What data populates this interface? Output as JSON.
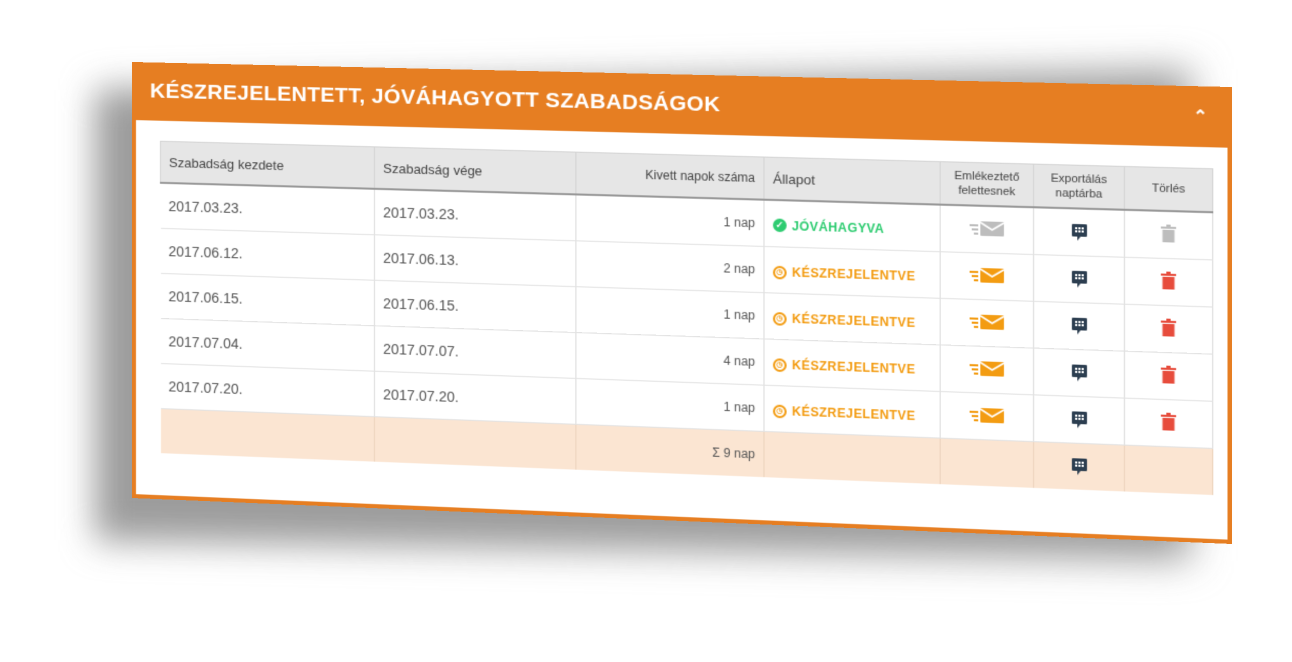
{
  "panel": {
    "title": "KÉSZREJELENTETT, JÓVÁHAGYOTT SZABADSÁGOK",
    "collapse_icon": "chevron-up-icon"
  },
  "table": {
    "headers": {
      "start": "Szabadság kezdete",
      "end": "Szabadság vége",
      "days": "Kivett napok száma",
      "status": "Állapot",
      "remind": "Emlékeztető felettesnek",
      "export": "Exportálás naptárba",
      "delete": "Törlés"
    },
    "rows": [
      {
        "start": "2017.03.23.",
        "end": "2017.03.23.",
        "days": "1 nap",
        "status": "JÓVÁHAGYVA",
        "status_type": "approved"
      },
      {
        "start": "2017.06.12.",
        "end": "2017.06.13.",
        "days": "2 nap",
        "status": "KÉSZREJELENTVE",
        "status_type": "pending"
      },
      {
        "start": "2017.06.15.",
        "end": "2017.06.15.",
        "days": "1 nap",
        "status": "KÉSZREJELENTVE",
        "status_type": "pending"
      },
      {
        "start": "2017.07.04.",
        "end": "2017.07.07.",
        "days": "4 nap",
        "status": "KÉSZREJELENTVE",
        "status_type": "pending"
      },
      {
        "start": "2017.07.20.",
        "end": "2017.07.20.",
        "days": "1 nap",
        "status": "KÉSZREJELENTVE",
        "status_type": "pending"
      }
    ],
    "sum": "Σ 9 nap"
  },
  "colors": {
    "accent": "#e67e22",
    "approved": "#2ecc71",
    "pending": "#f39c12",
    "delete": "#e74c3c",
    "disabled": "#bdbdbd",
    "calendar": "#2c3e50"
  },
  "icons": {
    "approved": "check-circle-icon",
    "pending": "clock-icon",
    "remind": "envelope-send-icon",
    "export": "calendar-export-icon",
    "delete": "trash-icon"
  }
}
